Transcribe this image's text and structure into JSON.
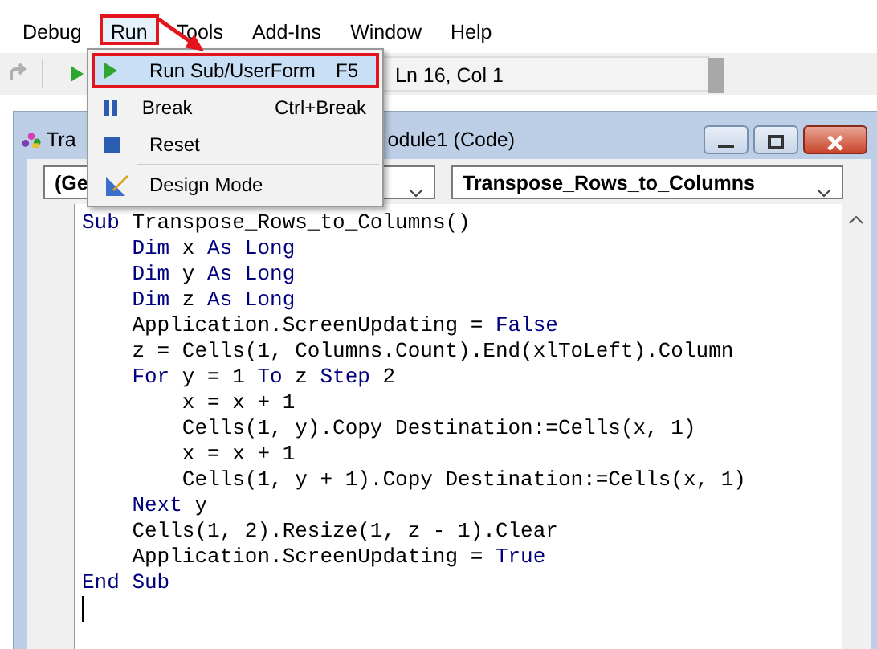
{
  "menu_bar": [
    {
      "label": "Debug",
      "selected": false,
      "highlighted": false
    },
    {
      "label": "Run",
      "selected": true,
      "highlighted": true
    },
    {
      "label": "Tools",
      "selected": false,
      "highlighted": false
    },
    {
      "label": "Add-Ins",
      "selected": false,
      "highlighted": false
    },
    {
      "label": "Window",
      "selected": false,
      "highlighted": false
    },
    {
      "label": "Help",
      "selected": false,
      "highlighted": false
    }
  ],
  "run_menu": [
    {
      "kind": "play",
      "label": "Run Sub/UserForm",
      "shortcut": "F5",
      "selected": true,
      "highlighted": true
    },
    {
      "kind": "pause",
      "label": "Break",
      "shortcut": "Ctrl+Break",
      "selected": false,
      "highlighted": false
    },
    {
      "kind": "stop",
      "label": "Reset",
      "selected": false,
      "highlighted": false
    },
    {
      "kind": "design",
      "label": "Design Mode",
      "selected": false,
      "highlighted": false,
      "separator_before": true
    }
  ],
  "toolbar": {
    "position": "Ln 16, Col 1"
  },
  "code_window": {
    "title_start": "Tra",
    "title_end": "odule1 (Code)",
    "object_box": "(Ge",
    "procedure_box": "Transpose_Rows_to_Columns",
    "lines": [
      [
        {
          "kind": "keyword",
          "text": "Sub"
        },
        {
          "kind": "plain",
          "text": " Transpose_Rows_to_Columns()"
        }
      ],
      [
        {
          "kind": "keyword",
          "text": "    Dim"
        },
        {
          "kind": "plain",
          "text": " x "
        },
        {
          "kind": "keyword",
          "text": "As Long"
        }
      ],
      [
        {
          "kind": "keyword",
          "text": "    Dim"
        },
        {
          "kind": "plain",
          "text": " y "
        },
        {
          "kind": "keyword",
          "text": "As Long"
        }
      ],
      [
        {
          "kind": "keyword",
          "text": "    Dim"
        },
        {
          "kind": "plain",
          "text": " z "
        },
        {
          "kind": "keyword",
          "text": "As Long"
        }
      ],
      [
        {
          "kind": "plain",
          "text": "    Application.ScreenUpdating = "
        },
        {
          "kind": "keyword",
          "text": "False"
        }
      ],
      [
        {
          "kind": "plain",
          "text": "    z = Cells(1, Columns.Count).End(xlToLeft).Column"
        }
      ],
      [
        {
          "kind": "keyword",
          "text": "    For"
        },
        {
          "kind": "plain",
          "text": " y = 1 "
        },
        {
          "kind": "keyword",
          "text": "To"
        },
        {
          "kind": "plain",
          "text": " z "
        },
        {
          "kind": "keyword",
          "text": "Step"
        },
        {
          "kind": "plain",
          "text": " 2"
        }
      ],
      [
        {
          "kind": "plain",
          "text": "        x = x + 1"
        }
      ],
      [
        {
          "kind": "plain",
          "text": "        Cells(1, y).Copy Destination:=Cells(x, 1)"
        }
      ],
      [
        {
          "kind": "plain",
          "text": "        x = x + 1"
        }
      ],
      [
        {
          "kind": "plain",
          "text": "        Cells(1, y + 1).Copy Destination:=Cells(x, 1)"
        }
      ],
      [
        {
          "kind": "keyword",
          "text": "    Next"
        },
        {
          "kind": "plain",
          "text": " y"
        }
      ],
      [
        {
          "kind": "plain",
          "text": "    Cells(1, 2).Resize(1, z - 1).Clear"
        }
      ],
      [
        {
          "kind": "plain",
          "text": "    Application.ScreenUpdating = "
        },
        {
          "kind": "keyword",
          "text": "True"
        }
      ],
      [
        {
          "kind": "keyword",
          "text": "End Sub"
        }
      ]
    ],
    "cursor": true
  }
}
